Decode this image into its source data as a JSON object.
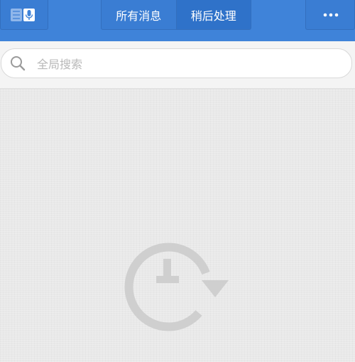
{
  "header": {
    "tabs": [
      {
        "label": "所有消息",
        "active": false
      },
      {
        "label": "稍后处理",
        "active": true
      }
    ],
    "left_icon": "notes-voice-icon",
    "right_icon": "more-dots-icon"
  },
  "search": {
    "placeholder": "全局搜索",
    "value": ""
  },
  "empty_state": {
    "icon": "clock-refresh-icon"
  },
  "colors": {
    "header_bg": "#3f83d9",
    "active_tab_bg": "#2f72c9",
    "page_bg": "#e9e9e9",
    "empty_icon": "#cfcfcf"
  }
}
